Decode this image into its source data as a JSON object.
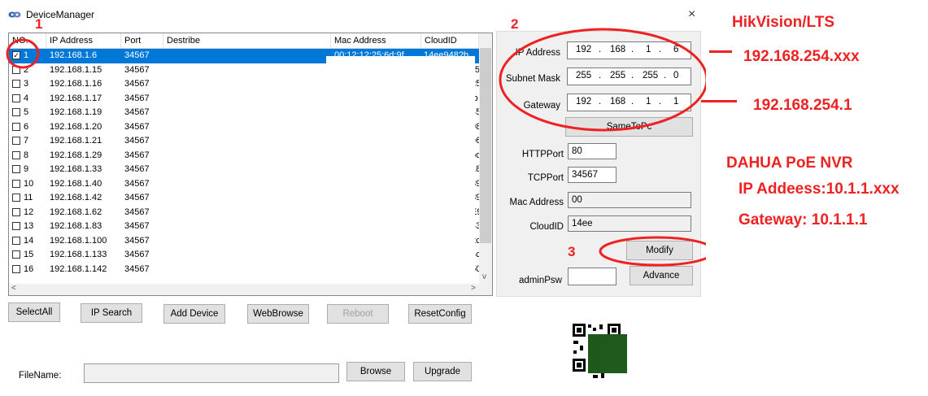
{
  "window": {
    "title": "DeviceManager",
    "close_glyph": "×"
  },
  "table": {
    "headers": [
      "NO.",
      "IP Address",
      "Port",
      "Destribe",
      "Mac Address",
      "CloudID"
    ],
    "rows": [
      {
        "no": "1",
        "ip": "192.168.1.6",
        "port": "34567",
        "checked": true,
        "mac_frag": "00:12:12:25:6d:9f",
        "cloud_frag": "14ee948?b"
      },
      {
        "no": "2",
        "ip": "192.168.1.15",
        "port": "34567",
        "cloud_frag": "ε5"
      },
      {
        "no": "3",
        "ip": "192.168.1.16",
        "port": "34567",
        "cloud_frag": "25"
      },
      {
        "no": "4",
        "ip": "192.168.1.17",
        "port": "34567",
        "cloud_frag": "lb"
      },
      {
        "no": "5",
        "ip": "192.168.1.19",
        "port": "34567",
        "cloud_frag": "45"
      },
      {
        "no": "6",
        "ip": "192.168.1.20",
        "port": "34567",
        "cloud_frag": "θ8"
      },
      {
        "no": "7",
        "ip": "192.168.1.21",
        "port": "34567",
        "cloud_frag": "e6"
      },
      {
        "no": "8",
        "ip": "192.168.1.29",
        "port": "34567",
        "cloud_frag": "oc"
      },
      {
        "no": "9",
        "ip": "192.168.1.33",
        "port": "34567",
        "cloud_frag": "18"
      },
      {
        "no": "10",
        "ip": "192.168.1.40",
        "port": "34567",
        "cloud_frag": "89"
      },
      {
        "no": "11",
        "ip": "192.168.1.42",
        "port": "34567",
        "cloud_frag": "89"
      },
      {
        "no": "12",
        "ip": "192.168.1.62",
        "port": "34567",
        "cloud_frag": "E9"
      },
      {
        "no": "13",
        "ip": "192.168.1.83",
        "port": "34567",
        "cloud_frag": "43"
      },
      {
        "no": "14",
        "ip": "192.168.1.100",
        "port": "34567",
        "cloud_frag": "2c"
      },
      {
        "no": "15",
        "ip": "192.168.1.133",
        "port": "34567",
        "cloud_frag": "4c"
      },
      {
        "no": "16",
        "ip": "192.168.1.142",
        "port": "34567",
        "cloud_frag": "50"
      }
    ]
  },
  "buttons": {
    "select_all": "SelectAll",
    "ip_search": "IP Search",
    "add_device": "Add Device",
    "web_browse": "WebBrowse",
    "reboot": "Reboot",
    "reset_config": "ResetConfig",
    "browse": "Browse",
    "upgrade": "Upgrade",
    "same_to_pc": "SameToPc",
    "modify": "Modify",
    "advance": "Advance"
  },
  "panel": {
    "ip_label": "IP Address",
    "ip_value": [
      "192",
      "168",
      "1",
      "6"
    ],
    "mask_label": "Subnet Mask",
    "mask_value": [
      "255",
      "255",
      "255",
      "0"
    ],
    "gateway_label": "Gateway",
    "gateway_value": [
      "192",
      "168",
      "1",
      "1"
    ],
    "http_label": "HTTPPort",
    "http_value": "80",
    "tcp_label": "TCPPort",
    "tcp_value": "34567",
    "mac_label": "Mac Address",
    "mac_value": "00",
    "cloud_label": "CloudID",
    "cloud_value": "14ee",
    "psw_label": "adminPsw",
    "psw_value": ""
  },
  "file": {
    "label": "FileName:",
    "value": ""
  },
  "annotations": {
    "n1": "1",
    "n2": "2",
    "n3": "3",
    "hik_title": "HikVision/LTS",
    "hik_ip": "192.168.254.xxx",
    "hik_gw": "192.168.254.1",
    "dahua_title": "DAHUA PoE NVR",
    "dahua_ip": "IP Addeess:10.1.1.xxx",
    "dahua_gw": "Gateway: 10.1.1.1",
    "color": "#ee2222"
  }
}
